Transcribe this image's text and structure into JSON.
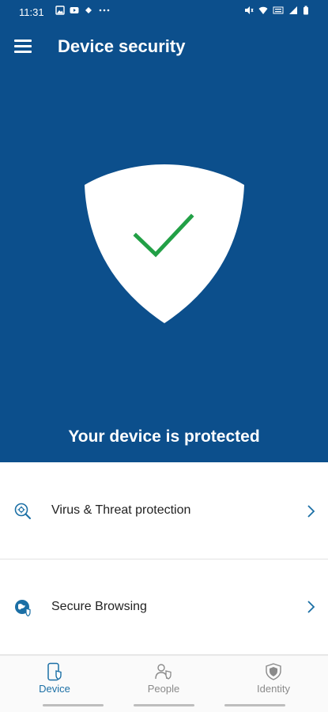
{
  "status_bar": {
    "time": "11:31",
    "left_icons": [
      "image-icon",
      "youtube-icon",
      "cast-icon",
      "more-dots-icon"
    ],
    "right_icons": [
      "mute-icon",
      "wifi-icon",
      "volte-icon",
      "signal-icon",
      "battery-icon"
    ]
  },
  "header": {
    "menu_icon": "hamburger-menu-icon",
    "title": "Device security"
  },
  "hero": {
    "icon": "shield-check-icon",
    "status_text": "Your device is protected"
  },
  "list": {
    "items": [
      {
        "label": "Virus & Threat protection",
        "icon": "virus-scan-icon"
      },
      {
        "label": "Secure Browsing",
        "icon": "globe-shield-icon"
      }
    ]
  },
  "bottom_nav": {
    "tabs": [
      {
        "label": "Device",
        "icon": "device-shield-icon",
        "active": true
      },
      {
        "label": "People",
        "icon": "people-icon",
        "active": false
      },
      {
        "label": "Identity",
        "icon": "identity-shield-icon",
        "active": false
      }
    ]
  },
  "colors": {
    "brand_blue": "#0c4f8c",
    "check_green": "#22a046",
    "accent_teal": "#1b6fa5"
  }
}
